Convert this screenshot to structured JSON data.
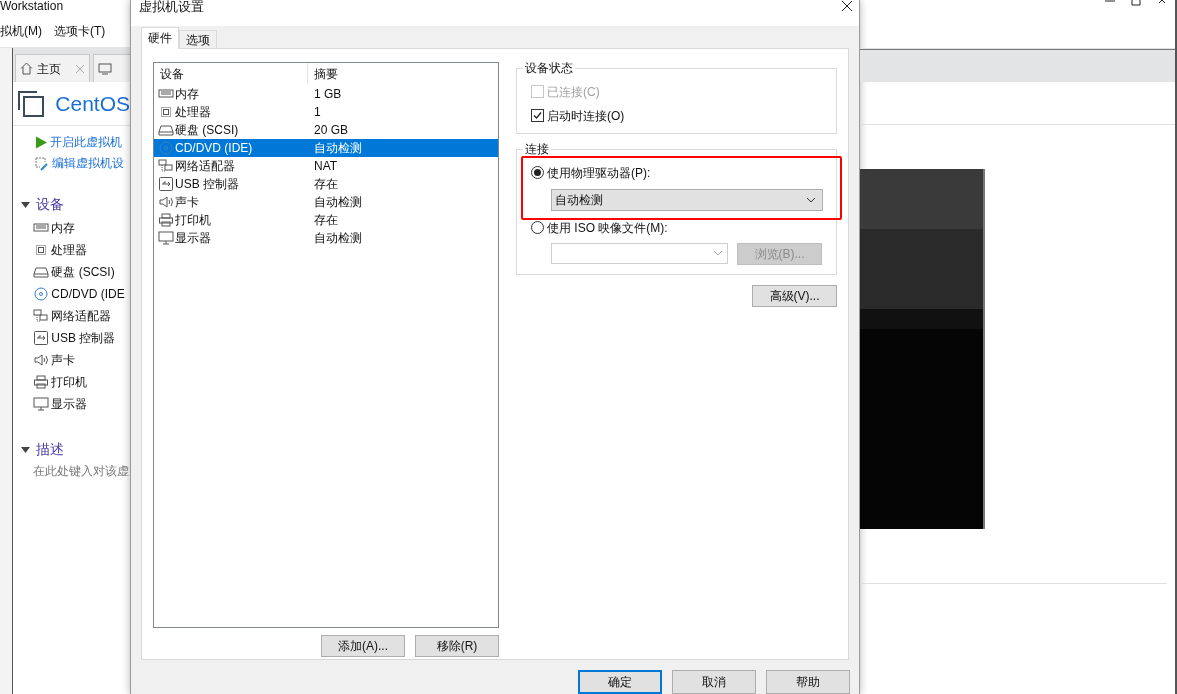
{
  "app": {
    "title": "Workstation",
    "menu": [
      "拟机(M)",
      "选项卡(T)"
    ],
    "home_tab": {
      "label": "主页",
      "selected": false
    },
    "vm_name": "CentOS",
    "actions": [
      {
        "kind": "play",
        "label": "开启此虚拟机"
      },
      {
        "kind": "edit",
        "label": "编辑虚拟机设"
      }
    ],
    "devices_section": {
      "title": "设备",
      "expanded": true,
      "items": [
        {
          "kind": "memory",
          "label": "内存"
        },
        {
          "kind": "cpu",
          "label": "处理器"
        },
        {
          "kind": "disk",
          "label": "硬盘 (SCSI)"
        },
        {
          "kind": "cd",
          "label": "CD/DVD (IDE"
        },
        {
          "kind": "network",
          "label": "网络适配器"
        },
        {
          "kind": "usb",
          "label": "USB 控制器"
        },
        {
          "kind": "sound",
          "label": "声卡"
        },
        {
          "kind": "printer",
          "label": "打印机"
        },
        {
          "kind": "display",
          "label": "显示器"
        }
      ]
    },
    "description_section": {
      "title": "描述",
      "expanded": true,
      "placeholder": "在此处键入对该虚"
    }
  },
  "dialog": {
    "title": "虚拟机设置",
    "tabs": [
      {
        "label": "硬件",
        "selected": true
      },
      {
        "label": "选项",
        "selected": false
      }
    ],
    "device_table": {
      "columns": [
        "设备",
        "摘要"
      ],
      "rows": [
        {
          "kind": "memory",
          "device": "内存",
          "summary": "1 GB",
          "selected": false
        },
        {
          "kind": "cpu",
          "device": "处理器",
          "summary": "1",
          "selected": false
        },
        {
          "kind": "disk",
          "device": "硬盘 (SCSI)",
          "summary": "20 GB",
          "selected": false
        },
        {
          "kind": "cd",
          "device": "CD/DVD (IDE)",
          "summary": "自动检测",
          "selected": true
        },
        {
          "kind": "network",
          "device": "网络适配器",
          "summary": "NAT",
          "selected": false
        },
        {
          "kind": "usb",
          "device": "USB 控制器",
          "summary": "存在",
          "selected": false
        },
        {
          "kind": "sound",
          "device": "声卡",
          "summary": "自动检测",
          "selected": false
        },
        {
          "kind": "printer",
          "device": "打印机",
          "summary": "存在",
          "selected": false
        },
        {
          "kind": "display",
          "device": "显示器",
          "summary": "自动检测",
          "selected": false
        }
      ]
    },
    "list_buttons": [
      "添加(A)...",
      "移除(R)"
    ],
    "device_status": {
      "title": "设备状态",
      "options": [
        {
          "label": "已连接(C)",
          "checked": false,
          "disabled": true
        },
        {
          "label": "启动时连接(O)",
          "checked": true,
          "disabled": false
        }
      ]
    },
    "connection": {
      "title": "连接",
      "physical": {
        "label": "使用物理驱动器(P):",
        "selected": true,
        "value": "自动检测",
        "highlighted": true
      },
      "iso": {
        "label": "使用 ISO 映像文件(M):",
        "selected": false,
        "browse_button": "浏览(B)...",
        "disabled": true
      }
    },
    "advanced_button": "高级(V)...",
    "footer_buttons": [
      {
        "label": "确定",
        "default": true
      },
      {
        "label": "取消",
        "default": false
      },
      {
        "label": "帮助",
        "default": false
      }
    ]
  }
}
